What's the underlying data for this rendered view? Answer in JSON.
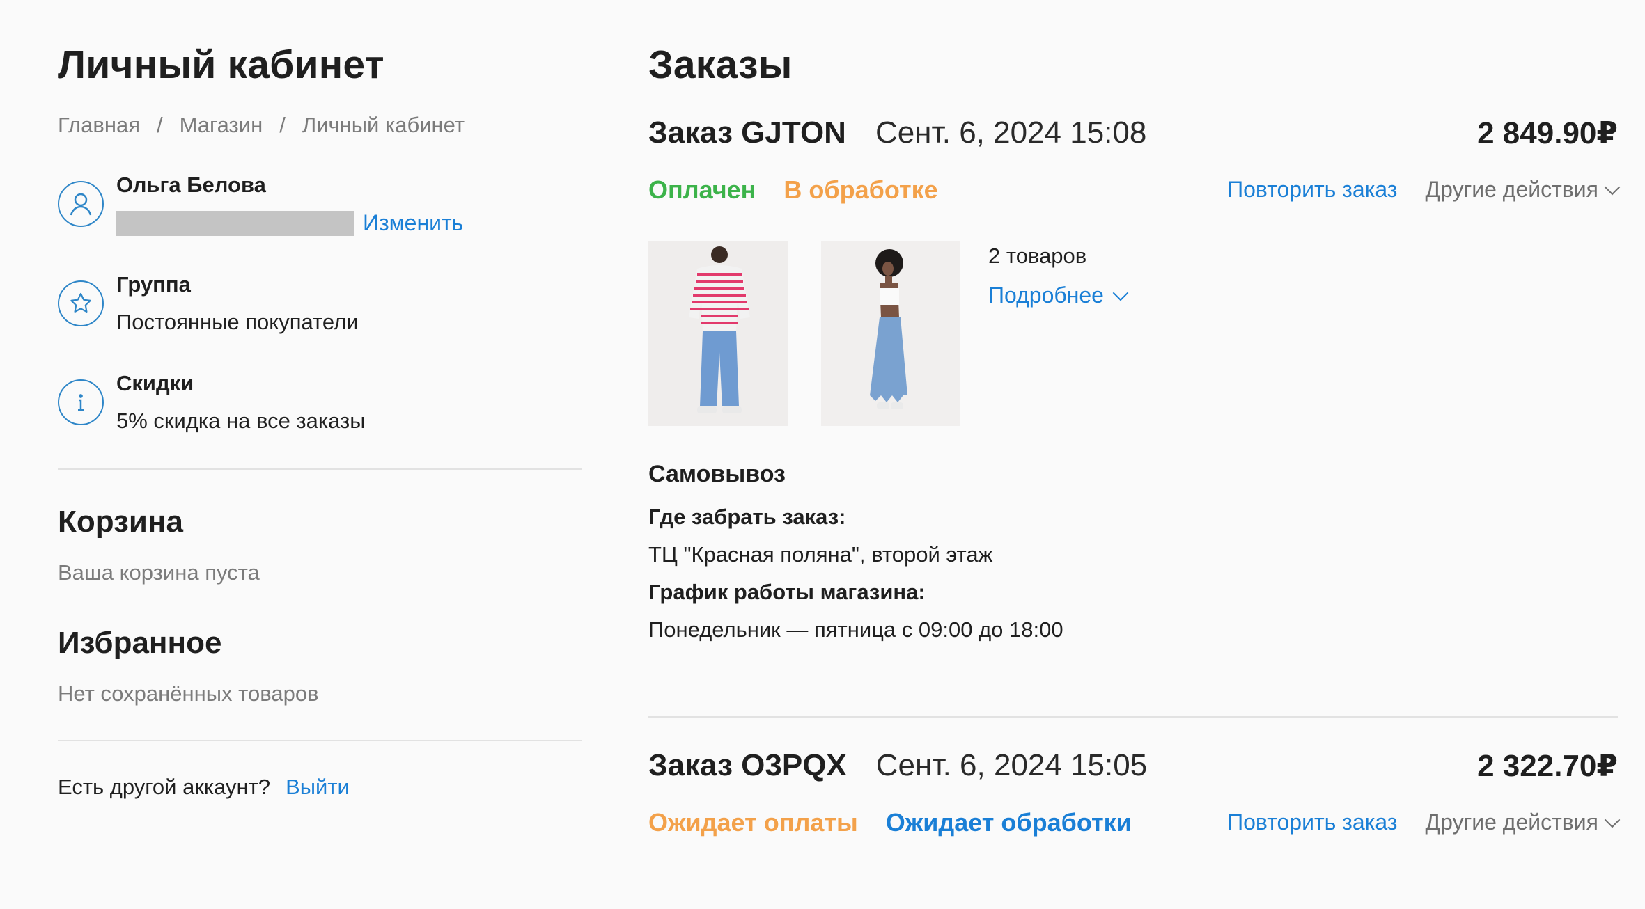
{
  "left": {
    "title": "Личный кабинет",
    "breadcrumbs": [
      "Главная",
      "Магазин",
      "Личный кабинет"
    ],
    "user": {
      "name": "Ольга Белова",
      "edit_label": "Изменить"
    },
    "group": {
      "title": "Группа",
      "value": "Постоянные покупатели"
    },
    "discounts": {
      "title": "Скидки",
      "value": "5% скидка на все заказы"
    },
    "cart": {
      "title": "Корзина",
      "empty_text": "Ваша корзина пуста"
    },
    "favorites": {
      "title": "Избранное",
      "empty_text": "Нет сохранённых товаров"
    },
    "account": {
      "question": "Есть другой аккаунт?",
      "logout_label": "Выйти"
    }
  },
  "orders": {
    "title": "Заказы",
    "list": [
      {
        "number": "Заказ GJTON",
        "date": "Сент. 6, 2024 15:08",
        "total": "2 849.90₽",
        "status_payment": "Оплачен",
        "status_processing": "В обработке",
        "repeat_label": "Повторить заказ",
        "other_label": "Другие действия",
        "items_count": "2 товаров",
        "details_label": "Подробнее",
        "delivery_title": "Самовывоз",
        "pickup_label": "Где забрать заказ:",
        "pickup_value": "ТЦ \"Красная поляна\", второй этаж",
        "hours_label": "График работы магазина:",
        "hours_value": "Понедельник — пятница с 09:00 до 18:00"
      },
      {
        "number": "Заказ O3PQX",
        "date": "Сент. 6, 2024 15:05",
        "total": "2 322.70₽",
        "status_payment": "Ожидает оплаты",
        "status_processing": "Ожидает обработки",
        "repeat_label": "Повторить заказ",
        "other_label": "Другие действия"
      }
    ]
  },
  "colors": {
    "accent": "#1a7fd6",
    "paid": "#3cb34a",
    "pending": "#f3a14a",
    "muted": "#7b7b7b"
  },
  "icons": [
    "user-icon",
    "star-icon",
    "info-icon",
    "chevron-down-icon"
  ]
}
